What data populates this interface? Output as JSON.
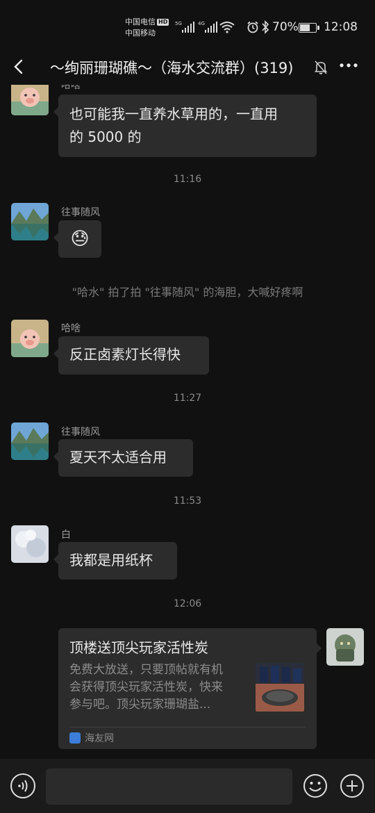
{
  "status_bar": {
    "carrier1": "中国电信",
    "hd_badge": "HD",
    "carrier2": "中国移动",
    "net1": "5G",
    "net2": "4G",
    "battery_percent": "70%",
    "battery_level": 0.7,
    "time": "12:08"
  },
  "nav": {
    "title": "～绚丽珊瑚礁～（海水交流群）(319)"
  },
  "messages": {
    "m1": {
      "sender": "哈啥",
      "line1": "也可能我一直养水草用的，一直用",
      "line2": "的 5000 的"
    },
    "t1": "11:16",
    "m2": {
      "sender": "往事随风",
      "emoji": "😓"
    },
    "system": "\"哈水\" 拍了拍 \"往事随风\" 的海胆，大喊好疼啊",
    "m3": {
      "sender": "哈啥",
      "text": "反正卤素灯长得快"
    },
    "t2": "11:27",
    "m4": {
      "sender": "往事随风",
      "text": "夏天不太适合用"
    },
    "t3": "11:53",
    "m5": {
      "sender": "白",
      "text": "我都是用纸杯"
    },
    "t4": "12:06",
    "card": {
      "title": "顶楼送顶尖玩家活性炭",
      "desc1": "免费大放送，只要顶帖就有机",
      "desc2": "会获得顶尖玩家活性炭，快来",
      "desc3": "参与吧。顶尖玩家珊瑚盐...",
      "source": "海友网"
    }
  },
  "colors": {
    "background": "#111111",
    "bubble": "#2c2c2c",
    "input_bar": "#1b1b1b"
  }
}
